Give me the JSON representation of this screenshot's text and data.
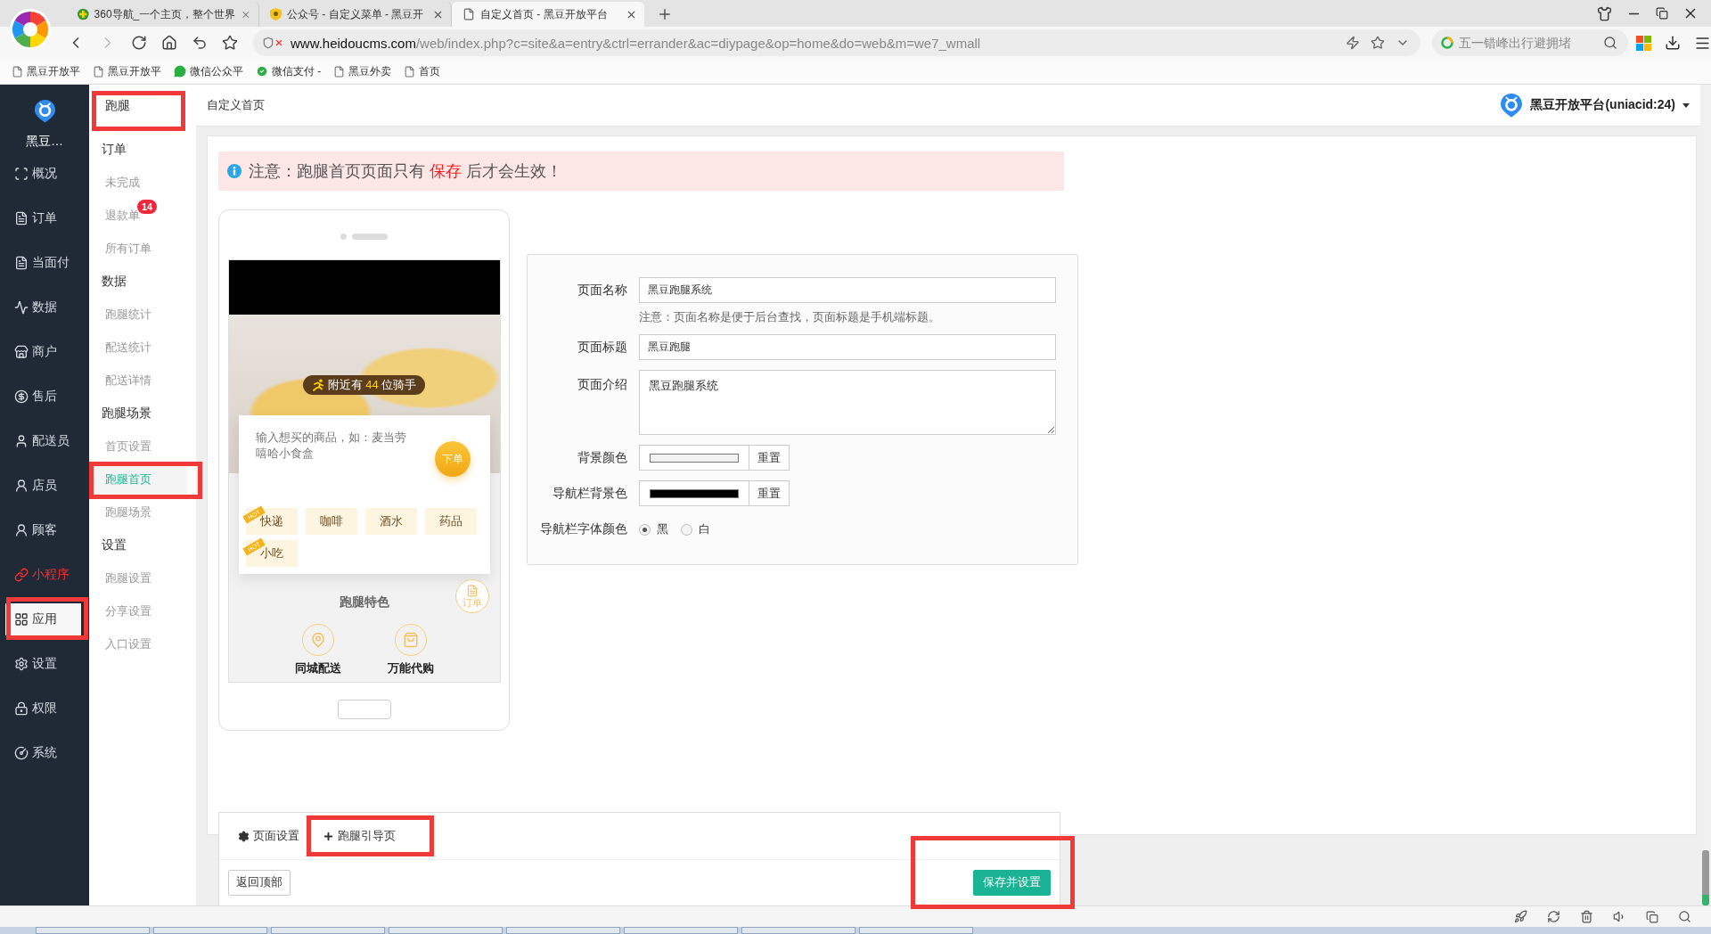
{
  "browser": {
    "tabs": [
      {
        "title": "360导航_一个主页，整个世界",
        "selected": false
      },
      {
        "title": "公众号 - 自定义菜单 - 黑豆开",
        "selected": false
      },
      {
        "title": "自定义首页 - 黑豆开放平台",
        "selected": true
      }
    ],
    "address": {
      "host": "www.heidoucms.com",
      "path": "/web/index.php?c=site&a=entry&ctrl=errander&ac=diypage&op=home&do=web&m=we7_wmall"
    },
    "search": {
      "placeholder": "五一错峰出行避拥堵"
    },
    "bookmarks": [
      {
        "label": "黑豆开放平",
        "kind": "page"
      },
      {
        "label": "黑豆开放平",
        "kind": "page"
      },
      {
        "label": "微信公众平",
        "kind": "chat"
      },
      {
        "label": "微信支付 -",
        "kind": "pay"
      },
      {
        "label": "黑豆外卖",
        "kind": "page"
      },
      {
        "label": "首页",
        "kind": "page"
      }
    ]
  },
  "sidebar": {
    "brand": "黑豆…",
    "items": [
      {
        "label": "概况",
        "kind": "plain",
        "selected": false,
        "highlighted": false
      },
      {
        "label": "订单",
        "kind": "plain",
        "selected": false,
        "highlighted": false
      },
      {
        "label": "当面付",
        "kind": "plain",
        "selected": false,
        "highlighted": false
      },
      {
        "label": "数据",
        "kind": "plain",
        "selected": false,
        "highlighted": false
      },
      {
        "label": "商户",
        "kind": "plain",
        "selected": false,
        "highlighted": false
      },
      {
        "label": "售后",
        "kind": "plain",
        "selected": false,
        "highlighted": false
      },
      {
        "label": "配送员",
        "kind": "plain",
        "selected": false,
        "highlighted": false
      },
      {
        "label": "店员",
        "kind": "plain",
        "selected": false,
        "highlighted": false
      },
      {
        "label": "顾客",
        "kind": "plain",
        "selected": false,
        "highlighted": false
      },
      {
        "label": "小程序",
        "kind": "accent",
        "selected": false,
        "highlighted": false
      },
      {
        "label": "应用",
        "kind": "plain",
        "selected": true,
        "highlighted": true
      },
      {
        "label": "设置",
        "kind": "plain",
        "selected": false,
        "highlighted": false
      },
      {
        "label": "权限",
        "kind": "plain",
        "selected": false,
        "highlighted": false
      },
      {
        "label": "系统",
        "kind": "plain",
        "selected": false,
        "highlighted": false
      }
    ]
  },
  "subnav": {
    "title": "跑腿",
    "highlighted": true,
    "groups": [
      {
        "title": "订单",
        "items": [
          {
            "label": "未完成",
            "selected": false,
            "highlighted": false
          },
          {
            "label": "退款单",
            "badge": "14",
            "selected": false,
            "highlighted": false
          },
          {
            "label": "所有订单",
            "selected": false,
            "highlighted": false
          }
        ]
      },
      {
        "title": "数据",
        "items": [
          {
            "label": "跑腿统计",
            "selected": false,
            "highlighted": false
          },
          {
            "label": "配送统计",
            "selected": false,
            "highlighted": false
          },
          {
            "label": "配送详情",
            "selected": false,
            "highlighted": false
          }
        ]
      },
      {
        "title": "跑腿场景",
        "items": [
          {
            "label": "首页设置",
            "selected": false,
            "highlighted": false
          },
          {
            "label": "跑腿首页",
            "selected": true,
            "highlighted": true
          },
          {
            "label": "跑腿场景",
            "selected": false,
            "highlighted": false
          }
        ]
      },
      {
        "title": "设置",
        "items": [
          {
            "label": "跑腿设置",
            "selected": false,
            "highlighted": false
          },
          {
            "label": "分享设置",
            "selected": false,
            "highlighted": false
          },
          {
            "label": "入口设置",
            "selected": false,
            "highlighted": false
          }
        ]
      }
    ]
  },
  "header": {
    "title": "自定义首页",
    "account": "黑豆开放平台(uniacid:24)"
  },
  "notice": {
    "before": "注意：跑腿首页页面只有",
    "emphasis": "保存",
    "after": "后才会生效！"
  },
  "preview": {
    "rider": {
      "before": "附近有",
      "count": "44",
      "after": "位骑手"
    },
    "order_placeholder": "输入想买的商品，如：麦当劳嘻哈小食盒",
    "order_button": "下单",
    "tags": [
      {
        "label": "快递",
        "ribbon": "HOT"
      },
      {
        "label": "咖啡"
      },
      {
        "label": "酒水"
      },
      {
        "label": "药品"
      },
      {
        "label": "小吃",
        "ribbon": "HOT"
      }
    ],
    "section_title": "跑腿特色",
    "float_button": "订单",
    "features": [
      {
        "label": "同城配送"
      },
      {
        "label": "万能代购"
      }
    ]
  },
  "form": {
    "fields": [
      {
        "kind": "text",
        "label": "页面名称",
        "value": "黑豆跑腿系统",
        "hint": "注意：页面名称是便于后台查找，页面标题是手机端标题。"
      },
      {
        "kind": "text",
        "label": "页面标题",
        "value": "黑豆跑腿"
      },
      {
        "kind": "textarea",
        "label": "页面介绍",
        "value": "黑豆跑腿系统"
      },
      {
        "kind": "color",
        "label": "背景颜色",
        "color": "#f2f2f2",
        "button": "重置"
      },
      {
        "kind": "color",
        "label": "导航栏背景色",
        "color": "#000000",
        "button": "重置"
      },
      {
        "kind": "radio",
        "label": "导航栏字体颜色",
        "options": [
          {
            "label": "黑",
            "selected": true
          },
          {
            "label": "白",
            "selected": false
          }
        ]
      }
    ]
  },
  "toolbar": {
    "tabs": [
      {
        "label": "页面设置",
        "highlighted": false
      },
      {
        "label": "跑腿引导页",
        "highlighted": true
      }
    ],
    "buttons": [
      {
        "label": "返回顶部",
        "kind": "default",
        "highlighted": false
      },
      {
        "label": "保存并设置",
        "kind": "primary",
        "highlighted": true
      }
    ]
  }
}
